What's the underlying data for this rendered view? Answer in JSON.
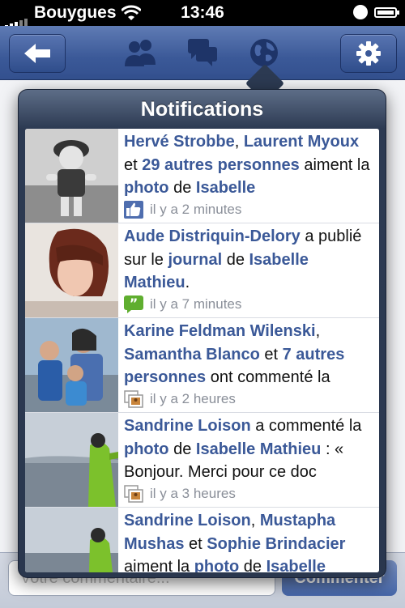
{
  "status_bar": {
    "carrier": "Bouygues",
    "time": "13:46"
  },
  "nav": {
    "back_icon": "back-arrow-icon",
    "friends_icon": "friends-icon",
    "messages_icon": "messages-icon",
    "notifications_icon": "globe-icon",
    "settings_icon": "gear-icon"
  },
  "background": {
    "comment_placeholder": "Votre commentaire...",
    "comment_button": "Commenter"
  },
  "popover": {
    "title": "Notifications",
    "items": [
      {
        "parts": [
          {
            "text": "Hervé Strobbe",
            "bold": true
          },
          {
            "text": ", ",
            "bold": false
          },
          {
            "text": "Laurent Myoux",
            "bold": true
          },
          {
            "text": " et ",
            "bold": false
          },
          {
            "text": "29 autres personnes",
            "bold": true
          },
          {
            "text": " aiment la ",
            "bold": false
          },
          {
            "text": "photo",
            "bold": true
          },
          {
            "text": " de ",
            "bold": false
          },
          {
            "text": "Isabelle",
            "bold": true
          }
        ],
        "time": "il y a 2 minutes",
        "icon": "like-thumb-icon"
      },
      {
        "parts": [
          {
            "text": "Aude Distriquin-Delory",
            "bold": true
          },
          {
            "text": " a publié sur le ",
            "bold": false
          },
          {
            "text": "journal",
            "bold": true
          },
          {
            "text": " de ",
            "bold": false
          },
          {
            "text": "Isabelle Mathieu",
            "bold": true
          },
          {
            "text": ".",
            "bold": false
          }
        ],
        "time": "il y a 7 minutes",
        "icon": "post-quote-icon"
      },
      {
        "parts": [
          {
            "text": "Karine Feldman Wilenski",
            "bold": true
          },
          {
            "text": ", ",
            "bold": false
          },
          {
            "text": "Samantha Blanco",
            "bold": true
          },
          {
            "text": " et ",
            "bold": false
          },
          {
            "text": "7 autres personnes",
            "bold": true
          },
          {
            "text": " ont commenté la",
            "bold": false
          }
        ],
        "time": "il y a 2 heures",
        "icon": "photo-comment-icon"
      },
      {
        "parts": [
          {
            "text": "Sandrine Loison",
            "bold": true
          },
          {
            "text": " a commenté la ",
            "bold": false
          },
          {
            "text": "photo",
            "bold": true
          },
          {
            "text": " de ",
            "bold": false
          },
          {
            "text": "Isabelle Mathieu",
            "bold": true
          },
          {
            "text": " : « Bonjour. Merci pour ce doc",
            "bold": false
          }
        ],
        "time": "il y a 3 heures",
        "icon": "photo-comment-icon"
      },
      {
        "parts": [
          {
            "text": "Sandrine Loison",
            "bold": true
          },
          {
            "text": ", ",
            "bold": false
          },
          {
            "text": "Mustapha Mushas",
            "bold": true
          },
          {
            "text": " et ",
            "bold": false
          },
          {
            "text": "Sophie Brindacier",
            "bold": true
          },
          {
            "text": " aiment la ",
            "bold": false
          },
          {
            "text": "photo",
            "bold": true
          },
          {
            "text": " de ",
            "bold": false
          },
          {
            "text": "Isabelle",
            "bold": true
          }
        ],
        "time": "",
        "icon": "like-thumb-icon"
      }
    ]
  },
  "colors": {
    "facebook_blue": "#3b5998",
    "popover_dark": "#2c3a52",
    "timestamp_gray": "#8a8f99"
  }
}
